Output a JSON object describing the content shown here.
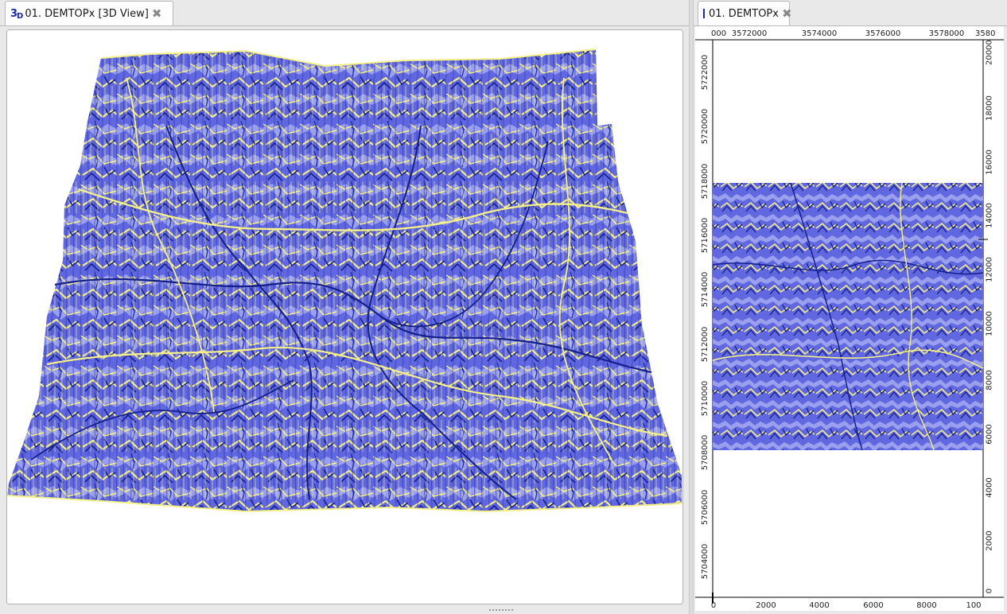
{
  "left_tab": {
    "icon": "3d-view-icon",
    "title": "01. DEMTOPx [3D View]"
  },
  "right_tab": {
    "icon": "map-icon",
    "title": "01. DEMTOPx"
  },
  "map": {
    "top_axis_ticks": [
      "000",
      "3572000",
      "3574000",
      "3576000",
      "3578000",
      "3580"
    ],
    "bottom_axis_ticks": [
      "0",
      "2000",
      "4000",
      "6000",
      "8000",
      "100"
    ],
    "left_axis_ticks": [
      "5722000",
      "5720000",
      "5718000",
      "5716000",
      "5714000",
      "5712000",
      "5710000",
      "5708000",
      "5706000",
      "5704000"
    ],
    "right_axis_ticks": [
      "20000",
      "18000",
      "16000",
      "14000",
      "12000",
      "10000",
      "8000",
      "6000",
      "4000",
      "2000",
      "0"
    ]
  },
  "colors": {
    "terrain_base": "#5f66e0",
    "terrain_light": "#9aa0ee",
    "ridge": "#f5f08a",
    "channel": "#141f8a"
  }
}
